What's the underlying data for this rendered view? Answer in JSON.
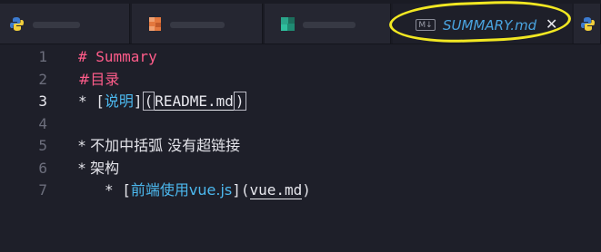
{
  "tabs": [
    {
      "name": "tab-python-file",
      "label": "",
      "icon": "python-icon"
    },
    {
      "name": "tab-orange-file",
      "label": "",
      "icon": "orange-file-icon"
    },
    {
      "name": "tab-green-file",
      "label": "",
      "icon": "green-file-icon"
    },
    {
      "name": "tab-summary",
      "label": "SUMMARY.md",
      "icon": "markdown-icon",
      "icon_text": "M↓",
      "close": "✕",
      "active": true
    },
    {
      "name": "tab-python-file-2",
      "label": "",
      "icon": "python-icon"
    }
  ],
  "editor": {
    "current_line": 3,
    "lines": [
      {
        "num": "1",
        "segments": [
          {
            "text": "# Summary",
            "style": "heading"
          }
        ]
      },
      {
        "num": "2",
        "segments": [
          {
            "text": "#目录",
            "style": "heading"
          }
        ]
      },
      {
        "num": "3",
        "segments": [
          {
            "text": "* [",
            "style": "plain"
          },
          {
            "text": "说明",
            "style": "link-text"
          },
          {
            "text": "]",
            "style": "plain"
          },
          {
            "text": "(",
            "style": "bracket"
          },
          {
            "text": "README.md",
            "style": "link-url"
          },
          {
            "text": ")",
            "style": "bracket"
          }
        ]
      },
      {
        "num": "4",
        "segments": []
      },
      {
        "num": "5",
        "segments": [
          {
            "text": "* 不加中括弧 没有超链接",
            "style": "plain"
          }
        ]
      },
      {
        "num": "6",
        "segments": [
          {
            "text": "* 架构",
            "style": "plain"
          }
        ]
      },
      {
        "num": "7",
        "indent": true,
        "segments": [
          {
            "text": "* [",
            "style": "plain"
          },
          {
            "text": "前端使用vue.js",
            "style": "link-text"
          },
          {
            "text": "](",
            "style": "plain"
          },
          {
            "text": "vue.md",
            "style": "link-url"
          },
          {
            "text": ")",
            "style": "plain"
          }
        ]
      }
    ]
  },
  "colors": {
    "background": "#1e1f29",
    "heading": "#ff5c8a",
    "link_text": "#4cb8ee",
    "tab_title": "#4aa4e0",
    "highlight": "#f2e822"
  }
}
